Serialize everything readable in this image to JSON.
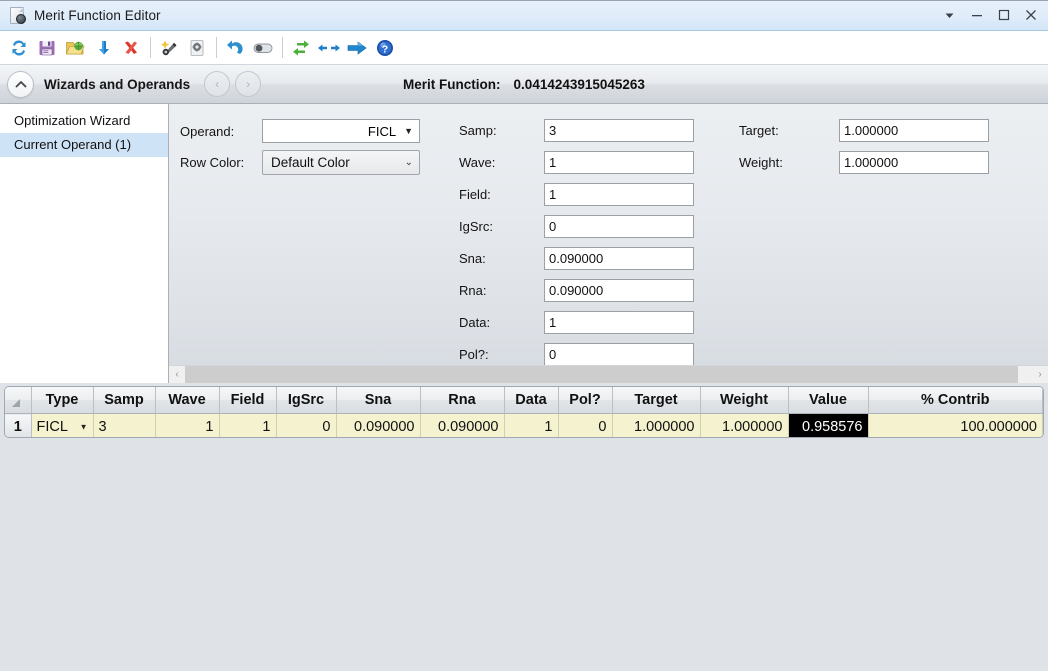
{
  "window": {
    "title": "Merit Function Editor",
    "icon": "document-gear-icon",
    "controls": {
      "dropdown": "▾",
      "minimize": "–",
      "maximize": "□",
      "close": "✕"
    }
  },
  "toolbar": {
    "buttons": [
      {
        "name": "refresh-update-icon",
        "tooltip": "Update"
      },
      {
        "name": "save-icon",
        "tooltip": "Save"
      },
      {
        "name": "load-folder-icon",
        "tooltip": "Load"
      },
      {
        "name": "insert-row-icon",
        "tooltip": "Insert"
      },
      {
        "name": "delete-row-icon",
        "tooltip": "Delete"
      },
      {
        "name": "wizard-wand-icon",
        "tooltip": "Wizard"
      },
      {
        "name": "settings-gear-icon",
        "tooltip": "Settings"
      },
      {
        "name": "undo-icon",
        "tooltip": "Undo"
      },
      {
        "name": "toggle-switch-icon",
        "tooltip": "Toggle"
      },
      {
        "name": "swap-arrows-icon",
        "tooltip": "Swap"
      },
      {
        "name": "collapse-arrows-icon",
        "tooltip": "Collapse"
      },
      {
        "name": "execute-arrow-icon",
        "tooltip": "Execute"
      },
      {
        "name": "help-icon",
        "tooltip": "Help"
      }
    ]
  },
  "section_header": {
    "collapse_icon": "chevron-up-icon",
    "title": "Wizards and Operands",
    "prev_label": "‹",
    "next_label": "›",
    "merit_label": "Merit Function:",
    "merit_value": "0.0414243915045263"
  },
  "sidebar": {
    "items": [
      {
        "label": "Optimization Wizard",
        "selected": false
      },
      {
        "label": "Current Operand (1)",
        "selected": true
      }
    ]
  },
  "form": {
    "operand": {
      "label": "Operand:",
      "value": "FICL"
    },
    "row_color": {
      "label": "Row Color:",
      "value": "Default Color"
    },
    "fields": [
      {
        "label": "Samp:",
        "value": "3"
      },
      {
        "label": "Wave:",
        "value": "1"
      },
      {
        "label": "Field:",
        "value": "1"
      },
      {
        "label": "IgSrc:",
        "value": "0"
      },
      {
        "label": "Sna:",
        "value": "0.090000"
      },
      {
        "label": "Rna:",
        "value": "0.090000"
      },
      {
        "label": "Data:",
        "value": "1"
      },
      {
        "label": "Pol?:",
        "value": "0"
      }
    ],
    "right_fields": [
      {
        "label": "Target:",
        "value": "1.000000"
      },
      {
        "label": "Weight:",
        "value": "1.000000"
      }
    ]
  },
  "scrollbar": {
    "left_arrow": "‹",
    "right_arrow": "›"
  },
  "grid": {
    "columns": [
      "Type",
      "Samp",
      "Wave",
      "Field",
      "IgSrc",
      "Sna",
      "Rna",
      "Data",
      "Pol?",
      "Target",
      "Weight",
      "Value",
      "% Contrib"
    ],
    "rows": [
      {
        "number": "1",
        "type": "FICL",
        "samp": "3",
        "wave": "1",
        "field": "1",
        "igsrc": "0",
        "sna": "0.090000",
        "rna": "0.090000",
        "data": "1",
        "pol": "0",
        "target": "1.000000",
        "weight": "1.000000",
        "value": "0.958576",
        "contrib": "100.000000"
      }
    ]
  },
  "colors": {
    "titlebar": "#e0ecfa",
    "selection": "#cfe3f7",
    "row_bg": "#f4f2cf",
    "cell_selected_bg": "#000000",
    "panel_bg": "#e7eaee"
  }
}
